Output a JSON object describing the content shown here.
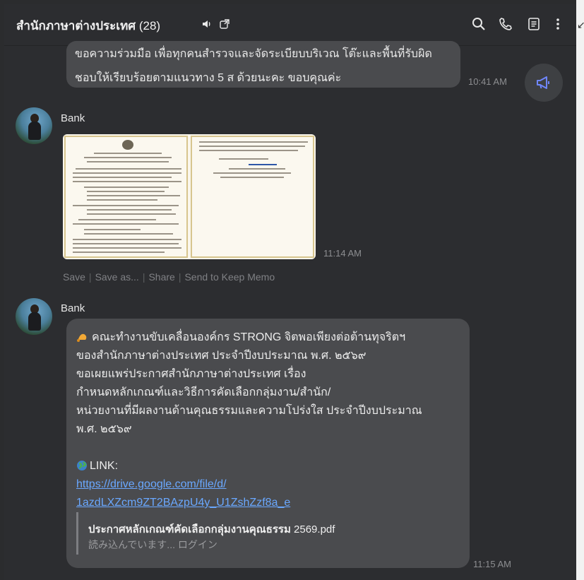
{
  "header": {
    "title": "สำนักภาษาต่างประเทศ",
    "member_count": "(28)"
  },
  "messages": {
    "first": {
      "text_cut": "ขอความร่วมมือ เพื่อทุกคนสำรวจและจัดระเบียบบริเวณ โต๊ะและพื้นที่รับผิด",
      "text_line2": "ชอบให้เรียบร้อยตามแนวทาง 5 ส ด้วยนะคะ ขอบคุณค่ะ",
      "time": "10:41 AM"
    },
    "image_message": {
      "sender": "Bank",
      "time": "11:14 AM",
      "actions": [
        "Save",
        "Save as...",
        "Share",
        "Send to Keep Memo"
      ]
    },
    "link_message": {
      "sender": "Bank",
      "lines": [
        "คณะทำงานขับเคลื่อนองค์กร STRONG จิตพอเพียงต่อต้านทุจริตฯ",
        "ของสำนักภาษาต่างประเทศ ประจำปีงบประมาณ พ.ศ. ๒๕๖๙",
        "ขอเผยแพร่ประกาศสำนักภาษาต่างประเทศ เรื่อง",
        "กำหนดหลักเกณฑ์และวิธีการคัดเลือกกลุ่มงาน/สำนัก/",
        "หน่วยงานที่มีผลงานด้านคุณธรรมและความโปร่งใส ประจำปีงบประมาณ",
        "พ.ศ. ๒๕๖๙"
      ],
      "link_label": "LINK:",
      "link_line1": "https://drive.google.com/file/d/",
      "link_line2": "1azdLXZcm9ZT2BAzpU4y_U1ZshZzf8a_e",
      "preview_title_bold": "ประกาศหลักเกณฑ์คัดเลือกกลุ่มงานคุณธรรม",
      "preview_title_rest": " 2569.pdf",
      "preview_sub": "読み込んでいます... ログイン",
      "time": "11:15 AM"
    }
  },
  "icons": {
    "header": [
      "speaker-icon",
      "external-window-icon",
      "search-icon",
      "phone-icon",
      "notes-icon",
      "more-icon"
    ],
    "accent": "#6f86ff",
    "link_color": "#6aa8ff"
  }
}
